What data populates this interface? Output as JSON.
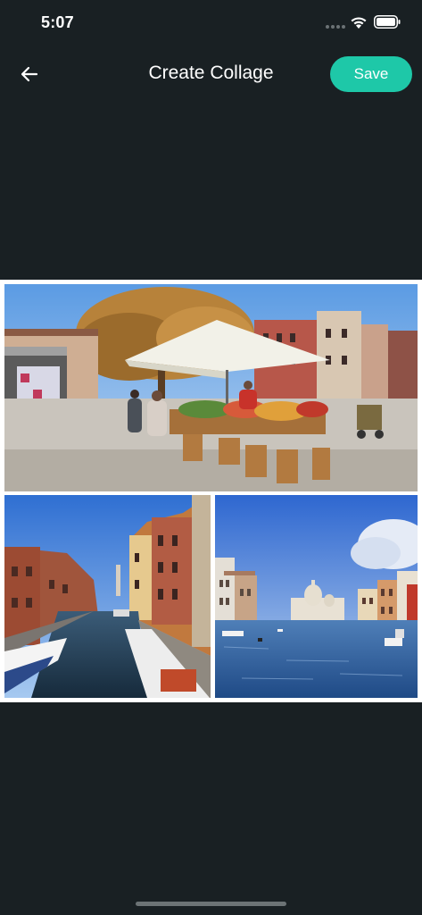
{
  "status_bar": {
    "time": "5:07"
  },
  "header": {
    "title": "Create Collage",
    "save_label": "Save",
    "back_icon": "arrow-left-icon"
  },
  "collage": {
    "photos": [
      {
        "name": "venice-market-stall-photo"
      },
      {
        "name": "venice-narrow-canal-photo"
      },
      {
        "name": "venice-grand-canal-photo"
      }
    ]
  },
  "colors": {
    "background": "#192023",
    "accent": "#1ec8a8",
    "collage_border": "#ffffff"
  }
}
